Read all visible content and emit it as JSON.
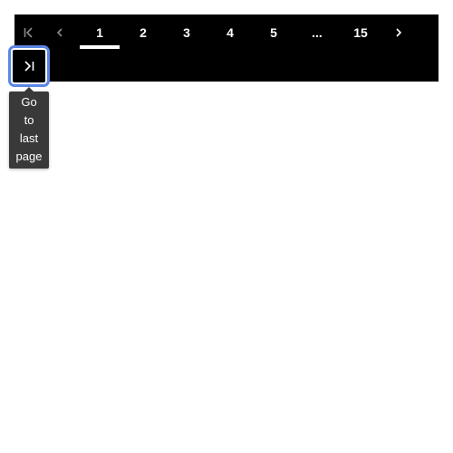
{
  "pagination": {
    "first_icon": "first-page-icon",
    "prev_icon": "chevron-left-icon",
    "pages": [
      "1",
      "2",
      "3",
      "4",
      "5"
    ],
    "current_page": "1",
    "ellipsis": "...",
    "last_page": "15",
    "next_icon": "chevron-right-icon",
    "last_icon": "last-page-icon"
  },
  "tooltip": {
    "lines": [
      "Go",
      "to",
      "last",
      "page"
    ]
  },
  "colors": {
    "bar_background": "#000000",
    "text": "#ffffff",
    "disabled": "#8a8a8a",
    "focus_ring": "#5b86e5",
    "tooltip_background": "#393939"
  }
}
